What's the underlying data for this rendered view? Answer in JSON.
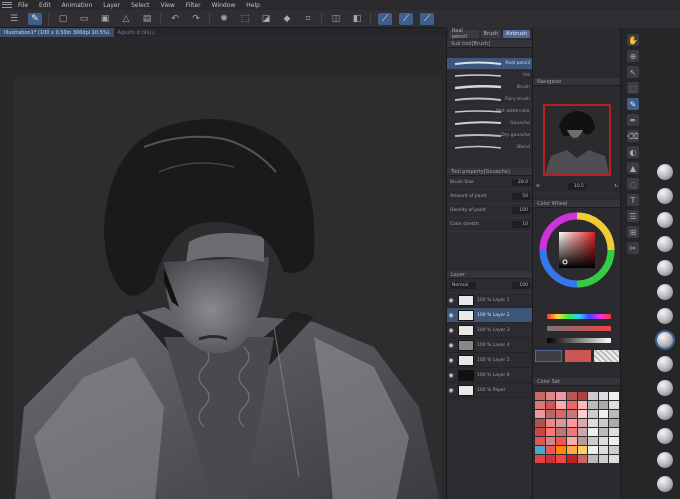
{
  "menu": {
    "items": [
      "File",
      "Edit",
      "Animation",
      "Layer",
      "Select",
      "View",
      "Filter",
      "Window",
      "Help"
    ]
  },
  "toolbar": {
    "icons": [
      "menu-icon",
      "pen-icon",
      "new-file-icon",
      "open-icon",
      "save-icon",
      "undo-icon",
      "redo-icon",
      "settings-icon",
      "select-icon",
      "clear-icon",
      "fill-icon",
      "crop-icon",
      "brush-a-icon",
      "brush-b-icon",
      "brush-c-icon"
    ]
  },
  "doc_tabs": [
    {
      "label": "Illustration1* (100 x 0.50in 300dpi 10.5%)",
      "active": true
    },
    {
      "label": "Agusto d (9x).j",
      "active": false
    }
  ],
  "subtool": {
    "tabs": [
      "Real pencil",
      "Brush",
      "Airbrush"
    ],
    "section_title": "Sub tool[Brush]"
  },
  "brushes": [
    {
      "name": "Real pencil",
      "active": true
    },
    {
      "name": "Ink",
      "active": false
    },
    {
      "name": "Brush",
      "active": false
    },
    {
      "name": "Fairy brush",
      "active": false
    },
    {
      "name": "Wet watercolor",
      "active": false
    },
    {
      "name": "Gouache",
      "active": false
    },
    {
      "name": "Dry gouache",
      "active": false
    },
    {
      "name": "Blend",
      "active": false
    }
  ],
  "tool_property": {
    "title": "Tool property[Gouache]",
    "rows": [
      {
        "label": "Brush Size",
        "value": "28.0"
      },
      {
        "label": "Amount of paint",
        "value": "50"
      },
      {
        "label": "Density of paint",
        "value": "100"
      },
      {
        "label": "Color stretch",
        "value": "10"
      }
    ]
  },
  "layer": {
    "title": "Layer",
    "blend": "Normal",
    "opacity": "100",
    "rows": [
      {
        "name": "100 % Layer 1",
        "thumb": "light",
        "selected": false
      },
      {
        "name": "100 % Layer 2",
        "thumb": "light",
        "selected": true
      },
      {
        "name": "100 % Layer 3",
        "thumb": "light",
        "selected": false
      },
      {
        "name": "100 % Layer 4",
        "thumb": "gray",
        "selected": false
      },
      {
        "name": "100 % Layer 5",
        "thumb": "light",
        "selected": false
      },
      {
        "name": "100 % Layer 6",
        "thumb": "dark",
        "selected": false
      },
      {
        "name": "100 % Paper",
        "thumb": "light",
        "selected": false
      }
    ]
  },
  "navigator": {
    "title": "Navigator",
    "zoom": "10.5"
  },
  "color": {
    "title": "Color Wheel",
    "accent": "#b51e22",
    "panel_accent": "#4b6a98"
  },
  "palette_title": "Color Set"
}
